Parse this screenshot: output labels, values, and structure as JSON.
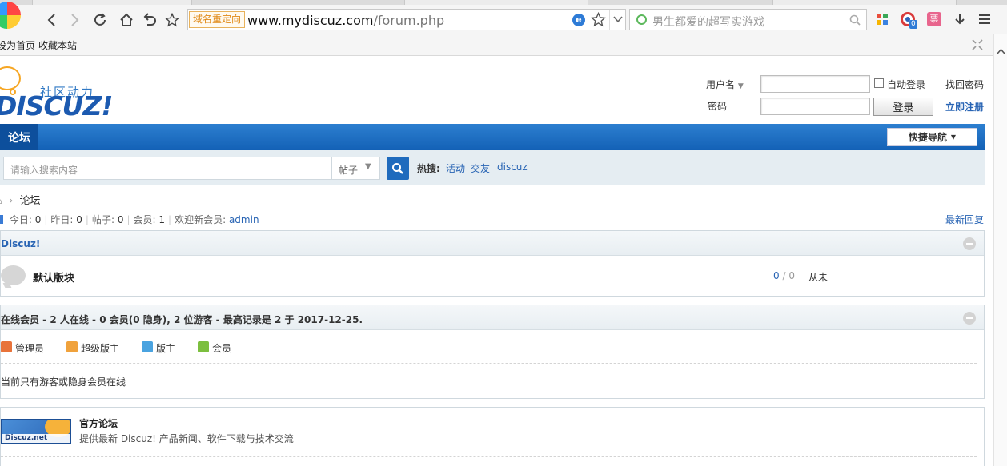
{
  "browser": {
    "addr_tag": "域名重定向",
    "url_host": "www.mydiscuz.com",
    "url_path": "/forum.php",
    "search_placeholder": "男生都爱的超写实游戏",
    "badge_count": "0"
  },
  "bookmarks": {
    "set_home": "设为首页",
    "bookmark_site": "收藏本站"
  },
  "logo": {
    "slogan": "社区动力",
    "name": "DISCUZ!"
  },
  "login": {
    "username_label": "用户名",
    "password_label": "密码",
    "autologin_label": "自动登录",
    "login_button": "登录",
    "forgot_password": "找回密码",
    "register": "立即注册"
  },
  "nav": {
    "current": "论坛",
    "quick_nav": "快捷导航"
  },
  "search": {
    "placeholder": "请输入搜索内容",
    "type": "帖子",
    "hot_label": "热搜:",
    "hot_links": [
      "活动",
      "交友",
      "discuz"
    ]
  },
  "breadcrumb": {
    "current": "论坛"
  },
  "stats": {
    "today_label": "今日:",
    "today": "0",
    "yesterday_label": "昨日:",
    "yesterday": "0",
    "posts_label": "帖子:",
    "posts": "0",
    "members_label": "会员:",
    "members": "1",
    "welcome_label": "欢迎新会员:",
    "newest_member": "admin",
    "latest_reply": "最新回复"
  },
  "category": {
    "title": "Discuz!",
    "forums": [
      {
        "name": "默认版块",
        "threads": "0",
        "sep": "/",
        "posts": "0",
        "last_post": "从未"
      }
    ]
  },
  "online": {
    "title": "在线会员 - 2 人在线 - 0 会员(0 隐身), 2 位游客 - 最高记录是 2 于 2017-12-25.",
    "roles": [
      {
        "label": "管理员",
        "color": "#e8733a"
      },
      {
        "label": "超级版主",
        "color": "#f0a23c"
      },
      {
        "label": "版主",
        "color": "#4aa3e0"
      },
      {
        "label": "会员",
        "color": "#7cbf3f"
      }
    ],
    "empty_text": "当前只有游客或隐身会员在线"
  },
  "links": {
    "title": "官方论坛",
    "description": "提供最新 Discuz! 产品新闻、软件下载与技术交流",
    "logo_text": "Discuz.net"
  }
}
